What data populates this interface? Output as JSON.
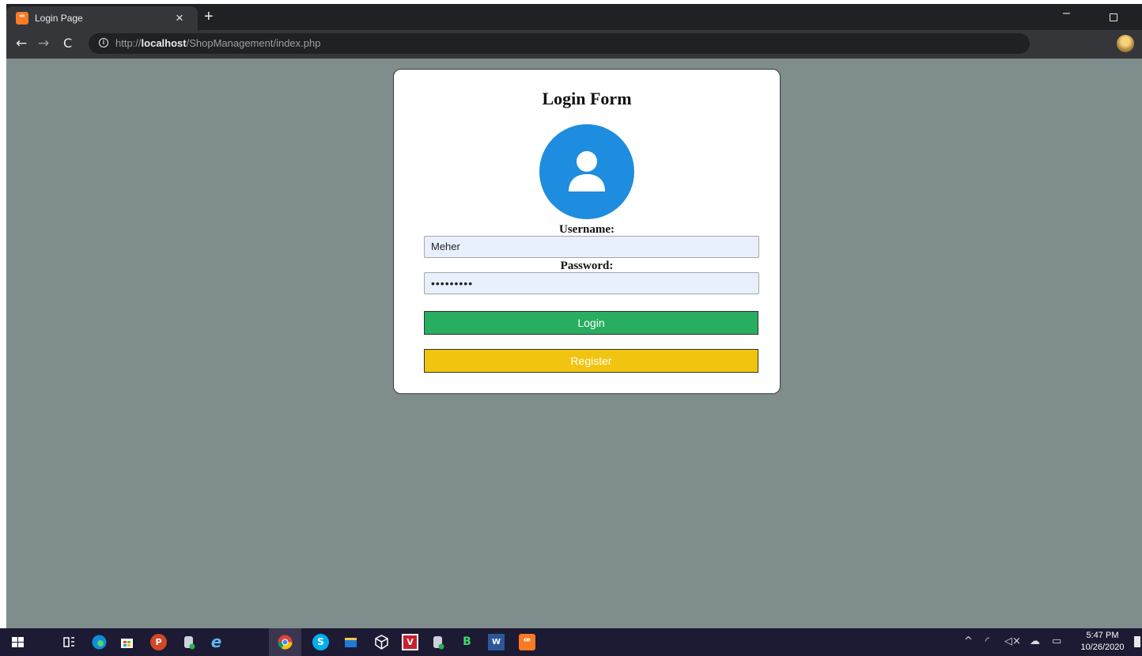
{
  "browser": {
    "tab": {
      "title": "Login Page",
      "close_glyph": "×",
      "favicon_text": "ꟹ"
    },
    "new_tab_glyph": "+",
    "window": {
      "minimize_glyph": "–"
    },
    "toolbar": {
      "back_glyph": "←",
      "forward_glyph": "→",
      "reload_glyph": "C",
      "url_prefix": "http://",
      "url_host": "localhost",
      "url_path": "/ShopManagement/index.php",
      "info_glyph": "i",
      "key_glyph": "⚷",
      "star_glyph": "☆"
    }
  },
  "login_form": {
    "title": "Login Form",
    "username_label": "Username:",
    "username_value": "Meher",
    "password_label": "Password:",
    "password_value": "•••••••••",
    "login_label": "Login",
    "register_label": "Register"
  },
  "taskbar": {
    "apps": [
      {
        "name": "start-icon"
      },
      {
        "name": "task-view-icon"
      },
      {
        "name": "edge-icon"
      },
      {
        "name": "store-icon"
      },
      {
        "name": "powerpoint-icon",
        "text": "P"
      },
      {
        "name": "database-icon"
      },
      {
        "name": "internet-explorer-icon",
        "text": "e"
      },
      {
        "name": "chrome-icon"
      },
      {
        "name": "skype-icon",
        "text": "S"
      },
      {
        "name": "file-explorer-icon"
      },
      {
        "name": "virtualbox-icon"
      },
      {
        "name": "vivaldi-icon",
        "text": "V"
      },
      {
        "name": "database-icon"
      },
      {
        "name": "bluej-icon",
        "text": "B"
      },
      {
        "name": "word-icon",
        "text": "W"
      },
      {
        "name": "xampp-icon",
        "text": "ꟹ"
      }
    ],
    "tray": {
      "chevron_glyph": "^",
      "time": "5:47 PM",
      "date": "10/26/2020"
    }
  }
}
